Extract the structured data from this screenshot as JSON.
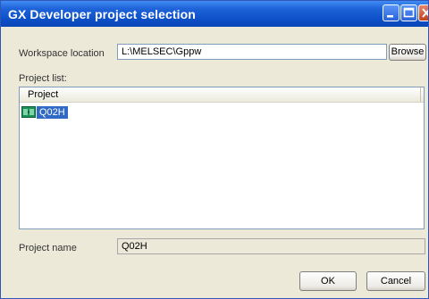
{
  "window": {
    "title": "GX Developer project selection",
    "controls": {
      "minimize": "minimize",
      "maximize": "maximize",
      "close": "close"
    }
  },
  "workspace": {
    "label": "Workspace location",
    "value": "L:\\MELSEC\\Gppw",
    "browse_label": "Browse"
  },
  "project_list": {
    "label": "Project list:",
    "column_header": "Project",
    "items": [
      {
        "name": "Q02H",
        "icon": "project-icon",
        "selected": true
      }
    ]
  },
  "project_name": {
    "label": "Project name",
    "value": "Q02H"
  },
  "buttons": {
    "ok": "OK",
    "cancel": "Cancel"
  },
  "colors": {
    "title_bar": "#0d50c9",
    "selection": "#316ac5",
    "dialog_bg": "#ece9d8"
  }
}
